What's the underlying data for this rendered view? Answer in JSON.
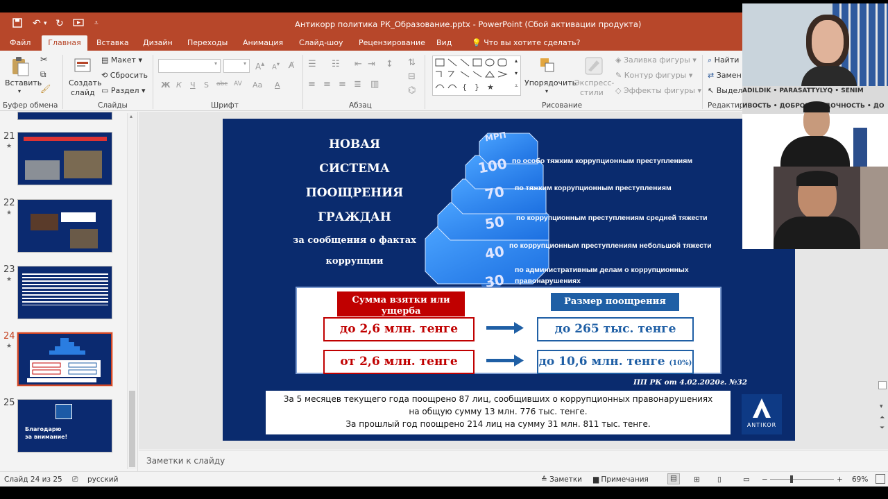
{
  "window": {
    "title": "Антикорр политика РК_Образование.pptx - PowerPoint (Сбой активации продукта)"
  },
  "tabs": [
    "Файл",
    "Главная",
    "Вставка",
    "Дизайн",
    "Переходы",
    "Анимация",
    "Слайд-шоу",
    "Рецензирование",
    "Вид"
  ],
  "active_tab": "Главная",
  "tell_me": "Что вы хотите сделать?",
  "ribbon": {
    "clipboard": {
      "label": "Буфер обмена",
      "paste": "Вставить"
    },
    "slides": {
      "label": "Слайды",
      "new_slide_1": "Создать",
      "new_slide_2": "слайд",
      "layout": "Макет",
      "reset": "Сбросить",
      "section": "Раздел"
    },
    "font": {
      "label": "Шрифт",
      "bold": "Ж",
      "italic": "К",
      "underline": "Ч",
      "shadow": "S",
      "strike": "abc",
      "spacing": "AV",
      "case": "Aa"
    },
    "paragraph": {
      "label": "Абзац"
    },
    "drawing": {
      "label": "Рисование",
      "arrange": "Упорядочить",
      "quick_styles_1": "Экспресс-",
      "quick_styles_2": "стили",
      "fill": "Заливка фигуры",
      "outline": "Контур фигуры",
      "effects": "Эффекты фигуры"
    },
    "editing": {
      "label": "Редактир",
      "find": "Найти",
      "replace": "Замен",
      "select": "Выдел"
    }
  },
  "thumbnails": [
    {
      "num": "21",
      "star": "★"
    },
    {
      "num": "22",
      "star": "★"
    },
    {
      "num": "23",
      "star": "★"
    },
    {
      "num": "24",
      "star": "★",
      "selected": true
    },
    {
      "num": "25",
      "text_1": "Благодарю",
      "text_2": "за внимание!"
    }
  ],
  "slide": {
    "title_lines": [
      "НОВАЯ",
      "СИСТЕМА",
      "ПООЩРЕНИЯ",
      "ГРАЖДАН"
    ],
    "subtitle_lines": [
      "за сообщения о фактах",
      "коррупции"
    ],
    "pyramid_top": "МРП",
    "steps": [
      {
        "num": "100",
        "label": "по особо тяжким коррупционным преступлениям"
      },
      {
        "num": "70",
        "label": "по тяжким коррупционным преступлениям"
      },
      {
        "num": "50",
        "label": "по коррупционным преступлениям средней тяжести"
      },
      {
        "num": "40",
        "label": "по коррупционным преступлениям небольшой тяжести"
      },
      {
        "num": "30",
        "label_1": "по административным делам о коррупционных",
        "label_2": "правонарушениях"
      }
    ],
    "header_left": "Сумма взятки или ущерба",
    "header_right": "Размер поощрения",
    "row1_left": "до 2,6 млн. тенге",
    "row1_right": "до 265 тыс. тенге",
    "row2_left": "от 2,6 млн. тенге",
    "row2_right": "до 10,6 млн. тенге",
    "row2_right_small": "(10%)",
    "reference": "ПП РК от 4.02.2020г. №32",
    "info_lines": [
      "За 5 месяцев текущего года поощрено 87 лиц, сообщивших о коррупционных правонарушениях",
      "на общую сумму 13 млн. 776 тыс. тенге.",
      "За прошлый год поощрено 214 лиц на сумму 31 млн. 811 тыс. тенге."
    ],
    "logo_text": "ANTIKOR"
  },
  "notes_placeholder": "Заметки к слайду",
  "status": {
    "slide_info": "Слайд 24 из 25",
    "language": "русский",
    "notes": "Заметки",
    "comments": "Примечания",
    "zoom": "69%"
  },
  "video": {
    "banner_1": "ADILDIK • PARASATTYLYQ • SENIM",
    "banner_2": "ИВОСТЬ • ДОБРОПОРЯДОЧНОСТЬ • ДО"
  },
  "colors": {
    "accent": "#b7472a",
    "slide_bg": "#0a2b6e",
    "red": "#c00000",
    "blue": "#1f5fa5"
  }
}
